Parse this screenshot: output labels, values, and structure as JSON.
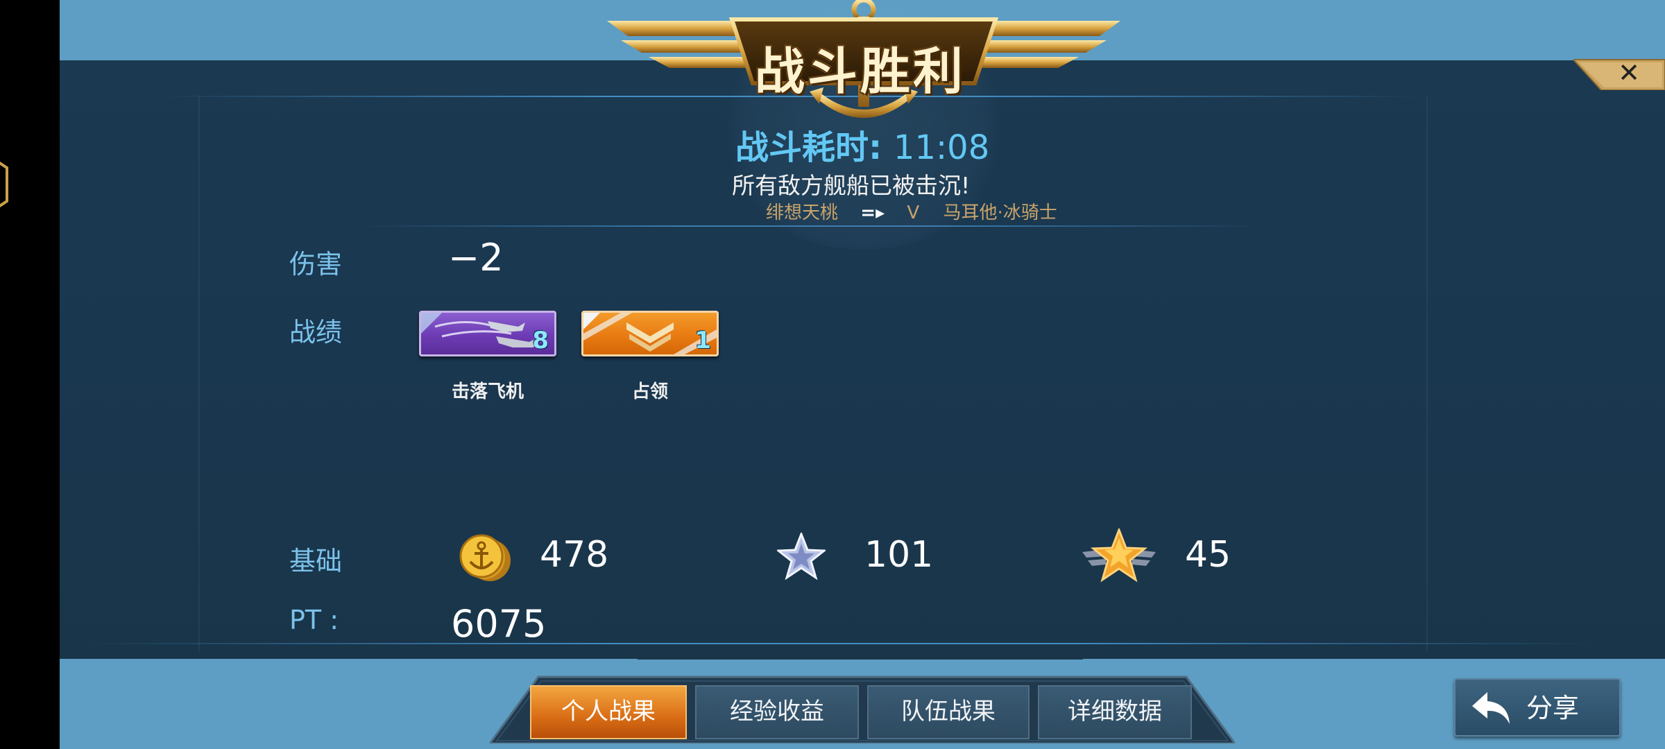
{
  "title": "战斗胜利",
  "battle": {
    "duration_label": "战斗耗时: ",
    "duration_value": "11:08",
    "result_message": "所有敌方舰船已被击沉!",
    "player_left": "绯想天桃",
    "vs": "V",
    "player_right": "马耳他·冰骑士"
  },
  "rows": {
    "damage_label": "伤害",
    "damage_value": "−2",
    "record_label": "战绩",
    "base_label": "基础",
    "pt_label": "PT :",
    "pt_value": "6075"
  },
  "medals": [
    {
      "name": "击落飞机",
      "count": "8",
      "icon": "planes-shot-down-medal"
    },
    {
      "name": "占领",
      "count": "1",
      "icon": "capture-chevron-medal"
    }
  ],
  "rewards": [
    {
      "icon": "gold-anchor-coin-icon",
      "value": "478"
    },
    {
      "icon": "silver-star-icon",
      "value": "101"
    },
    {
      "icon": "winged-gold-star-icon",
      "value": "45"
    }
  ],
  "tabs": [
    {
      "label": "个人战果",
      "active": true
    },
    {
      "label": "经验收益",
      "active": false
    },
    {
      "label": "队伍战果",
      "active": false
    },
    {
      "label": "详细数据",
      "active": false
    }
  ],
  "share_label": "分享",
  "colors": {
    "panel": "#1a3750",
    "accent_blue": "#63c8f4",
    "label_blue": "#7cc2ea",
    "gold": "#d9a441",
    "active_tab": "#e97b13"
  }
}
